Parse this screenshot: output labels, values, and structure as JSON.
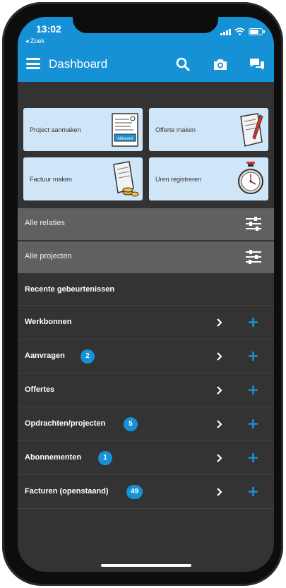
{
  "status": {
    "time": "13:02",
    "back_label": "◂ Zoek"
  },
  "appbar": {
    "title": "Dashboard"
  },
  "tiles": [
    {
      "label": "Project aanmaken",
      "icon": "form-icon",
      "stamp": "Akkoord"
    },
    {
      "label": "Offerte maken",
      "icon": "document-pen-icon"
    },
    {
      "label": "Factuur maken",
      "icon": "invoice-coins-icon"
    },
    {
      "label": "Uren registreren",
      "icon": "stopwatch-icon"
    }
  ],
  "filters": [
    {
      "label": "Alle relaties",
      "icon": "filter-sliders-icon"
    },
    {
      "label": "Alle projecten",
      "icon": "filter-sliders-icon"
    }
  ],
  "recent": {
    "label": "Recente gebeurtenissen"
  },
  "rows": [
    {
      "label": "Werkbonnen",
      "badge": null
    },
    {
      "label": "Aanvragen",
      "badge": "2"
    },
    {
      "label": "Offertes",
      "badge": null
    },
    {
      "label": "Opdrachten/projecten",
      "badge": "5"
    },
    {
      "label": "Abonnementen",
      "badge": "1"
    },
    {
      "label": "Facturen (openstaand)",
      "badge": "49"
    }
  ],
  "colors": {
    "accent": "#1791d6",
    "background": "#333333",
    "tile": "#cfe6f9",
    "filter": "#606060"
  }
}
